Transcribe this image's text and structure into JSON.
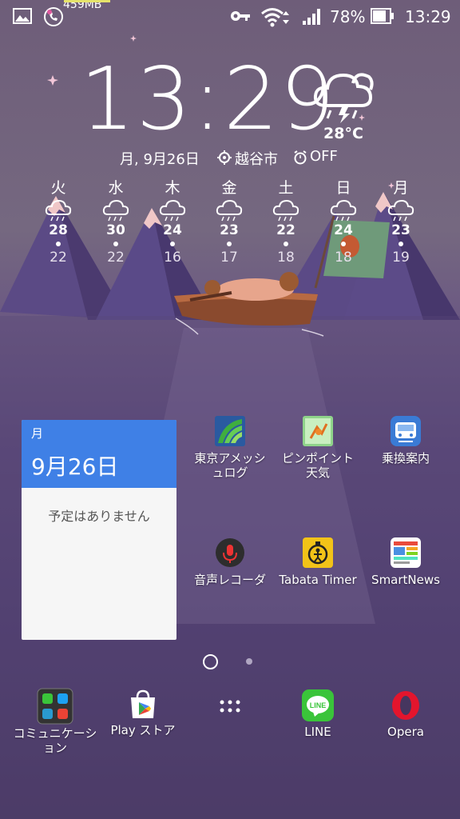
{
  "status_bar": {
    "memory": "459MB",
    "battery": "78%",
    "time": "13:29",
    "icons": [
      "gallery-icon",
      "call-icon",
      "key-icon",
      "wifi-icon",
      "signal-icon",
      "battery-icon"
    ]
  },
  "clock_widget": {
    "time": "13:29",
    "temperature": "28°C",
    "date": "月, 9月26日",
    "city": "越谷市",
    "alarm": "OFF",
    "forecast": [
      {
        "day": "火",
        "hi": "28",
        "lo": "22"
      },
      {
        "day": "水",
        "hi": "30",
        "lo": "22"
      },
      {
        "day": "木",
        "hi": "24",
        "lo": "16"
      },
      {
        "day": "金",
        "hi": "23",
        "lo": "17"
      },
      {
        "day": "土",
        "hi": "22",
        "lo": "18"
      },
      {
        "day": "日",
        "hi": "24",
        "lo": "18"
      },
      {
        "day": "月",
        "hi": "23",
        "lo": "19"
      }
    ]
  },
  "calendar_widget": {
    "weekday": "月",
    "date": "9月26日",
    "empty_text": "予定はありません"
  },
  "apps": {
    "tokyo_amesh": "東京アメッシュログ",
    "pinpoint": "ピンポイント天気",
    "norikae": "乗換案内",
    "voice_recorder": "音声レコーダ",
    "tabata": "Tabata Timer",
    "smartnews": "SmartNews"
  },
  "dock": {
    "communication": "コミュニケーション",
    "play_store": "Play ストア",
    "line": "LINE",
    "opera": "Opera"
  },
  "colors": {
    "calendar_header": "#3f80e6",
    "line_green": "#3ac43a",
    "opera_red": "#e3152d"
  }
}
